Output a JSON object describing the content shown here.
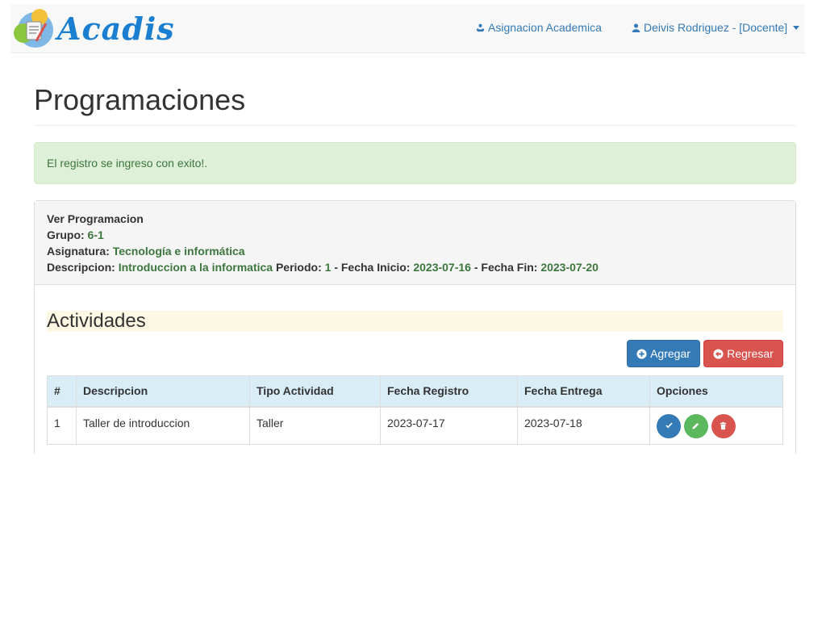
{
  "navbar": {
    "brand": "Acadis",
    "assign_link": "Asignacion Academica",
    "user_menu": "Deivis Rodriguez - [Docente]",
    "icons": {
      "assign": "users-icon",
      "user": "user-icon"
    }
  },
  "page": {
    "title": "Programaciones"
  },
  "alert": {
    "message": "El registro se ingreso con exito!."
  },
  "panel": {
    "heading": "Ver Programacion",
    "grupo_label": "Grupo:",
    "grupo_value": "6-1",
    "asignatura_label": "Asignatura:",
    "asignatura_value": "Tecnología e informática",
    "descripcion_label": "Descripcion:",
    "descripcion_value": "Introduccion a la informatica",
    "periodo_label": "Periodo:",
    "periodo_value": "1",
    "fecha_inicio_label": "- Fecha Inicio:",
    "fecha_inicio_value": "2023-07-16",
    "fecha_fin_label": "- Fecha Fin:",
    "fecha_fin_value": "2023-07-20"
  },
  "activities": {
    "title": "Actividades",
    "add_button": "Agregar",
    "back_button": "Regresar",
    "columns": [
      "#",
      "Descripcion",
      "Tipo Actividad",
      "Fecha Registro",
      "Fecha Entrega",
      "Opciones"
    ],
    "rows": [
      [
        "1",
        "Taller de introduccion",
        "Taller",
        "2023-07-17",
        "2023-07-18"
      ]
    ],
    "row_actions": [
      "check-icon",
      "pencil-icon",
      "trash-icon"
    ]
  },
  "colors": {
    "primary": "#337ab7",
    "success": "#5cb85c",
    "danger": "#d9534f",
    "alert_bg": "#dff0d8",
    "table_header_bg": "#d9edf7",
    "section_bg": "#fcf8e3"
  }
}
